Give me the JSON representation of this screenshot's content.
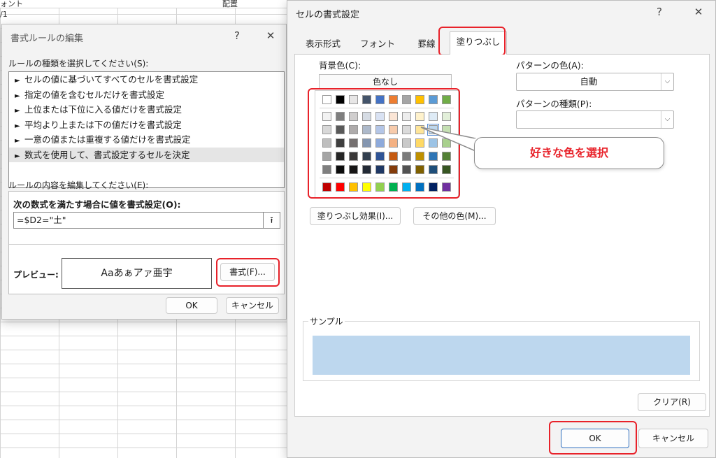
{
  "sheet": {
    "header_left": "ォント",
    "header_mid": "配置",
    "row_hint": "/1"
  },
  "rule_dialog": {
    "title": "書式ルールの編集",
    "help": "?",
    "close": "✕",
    "rule_type_label": "ルールの種類を選択してください(S):",
    "rule_types": [
      "セルの値に基づいてすべてのセルを書式設定",
      "指定の値を含むセルだけを書式設定",
      "上位または下位に入る値だけを書式設定",
      "平均より上または下の値だけを書式設定",
      "一意の値または重複する値だけを書式設定",
      "数式を使用して、書式設定するセルを決定"
    ],
    "selected_rule_index": 5,
    "rule_edit_label": "ルールの内容を編集してください(E):",
    "formula_label": "次の数式を満たす場合に値を書式設定(O):",
    "formula_value": "=$D2=\"土\"",
    "formula_btn_icon": "⭱",
    "preview_label": "プレビュー:",
    "preview_text": "Aaあぁアァ亜宇",
    "format_button": "書式(F)...",
    "ok": "OK",
    "cancel": "キャンセル"
  },
  "cell_dialog": {
    "title": "セルの書式設定",
    "help": "?",
    "close": "✕",
    "tabs": [
      "表示形式",
      "フォント",
      "罫線",
      "塗りつぶし"
    ],
    "active_tab": "塗りつぶし",
    "background_color_label": "背景色(C):",
    "no_color": "色なし",
    "pattern_color_label": "パターンの色(A):",
    "pattern_color_value": "自動",
    "pattern_type_label": "パターンの種類(P):",
    "pattern_type_value": "",
    "callout": "好きな色を選択",
    "fill_effects": "塗りつぶし効果(I)...",
    "more_colors": "その他の色(M)...",
    "sample_label": "サンプル",
    "sample_color": "#bdd7ee",
    "clear": "クリア(R)",
    "ok": "OK",
    "cancel": "キャンセル",
    "highlight_color": "#e8222a",
    "palette": {
      "theme_top": [
        "#ffffff",
        "#000000",
        "#e7e6e6",
        "#44546a",
        "#4472c4",
        "#ed7d31",
        "#a5a5a5",
        "#ffc000",
        "#5b9bd5",
        "#70ad47"
      ],
      "theme_shades": [
        [
          "#f2f2f2",
          "#7f7f7f",
          "#d0cece",
          "#d6dce4",
          "#d9e2f3",
          "#fbe5d5",
          "#ededed",
          "#fff2cc",
          "#deebf6",
          "#e2efd9"
        ],
        [
          "#d8d8d8",
          "#595959",
          "#aeabab",
          "#adb9ca",
          "#b4c6e7",
          "#f7cbac",
          "#dbdbdb",
          "#fee599",
          "#bdd7ee",
          "#c5e0b3"
        ],
        [
          "#bfbfbf",
          "#3f3f3f",
          "#757070",
          "#8496b0",
          "#8eaadb",
          "#f4b183",
          "#c9c9c9",
          "#ffd965",
          "#9cc3e5",
          "#a8d08d"
        ],
        [
          "#a5a5a5",
          "#262626",
          "#3a3838",
          "#323f4f",
          "#2f5496",
          "#c55a11",
          "#7b7b7b",
          "#bf9000",
          "#2e75b5",
          "#538135"
        ],
        [
          "#7f7f7f",
          "#0c0c0c",
          "#171616",
          "#222a35",
          "#1f3864",
          "#833c0b",
          "#525252",
          "#7f6000",
          "#1e4e79",
          "#375623"
        ]
      ],
      "standard": [
        "#c00000",
        "#ff0000",
        "#ffc000",
        "#ffff00",
        "#92d050",
        "#00b050",
        "#00b0f0",
        "#0070c0",
        "#002060",
        "#7030a0"
      ],
      "selected": {
        "row": 1,
        "col": 8
      }
    }
  }
}
